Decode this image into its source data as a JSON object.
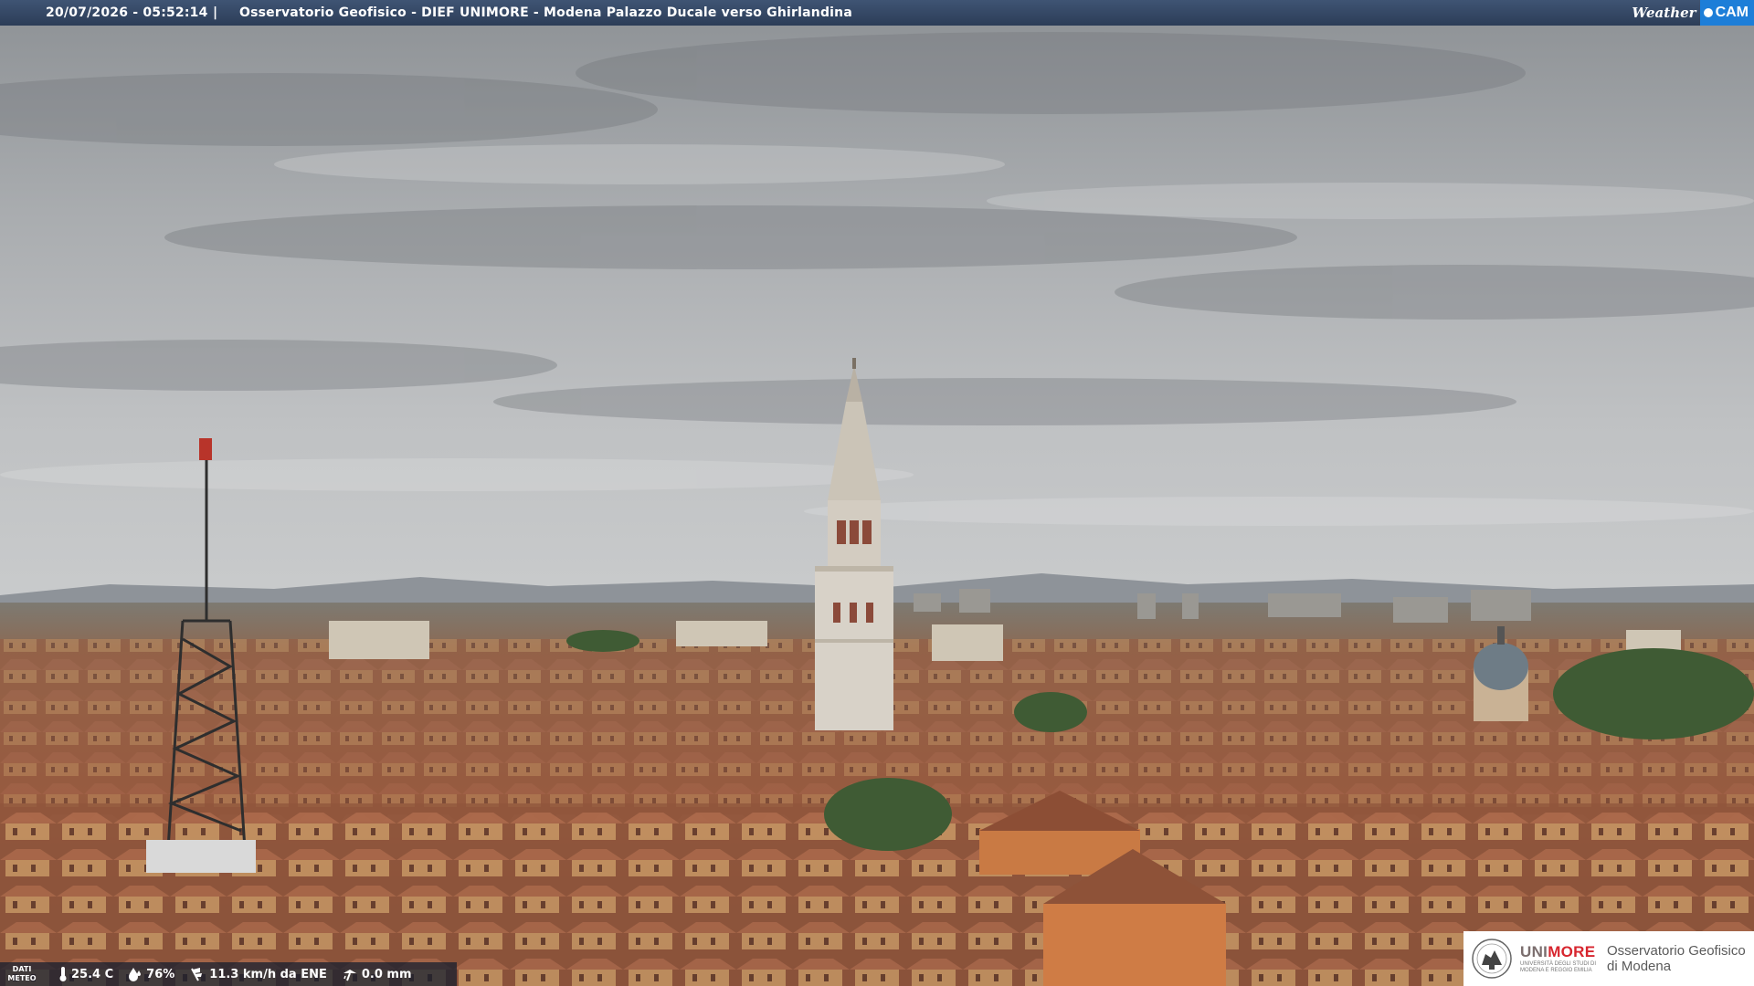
{
  "overlay": {
    "datetime": "20/07/2026 - 05:52:14",
    "separator": "|",
    "title": "Osservatorio Geofisico - DIEF UNIMORE - Modena Palazzo Ducale verso Ghirlandina"
  },
  "brand": {
    "weather": "Weather",
    "cam": "CAM"
  },
  "weather_bar": {
    "label_line1": "DATI",
    "label_line2": "METEO",
    "temperature": "25.4 C",
    "humidity": "76%",
    "wind": "11.3 km/h da ENE",
    "rain": "0.0 mm",
    "icons": [
      "thermometer-icon",
      "humidity-drop-icon",
      "wind-icon",
      "rain-gauge-icon"
    ]
  },
  "logo": {
    "name_part1": "UNI",
    "name_part2": "MORE",
    "subtitle_line1": "UNIVERSITÀ DEGLI STUDI DI",
    "subtitle_line2": "MODENA E REGGIO EMILIA",
    "observatory_line1": "Osservatorio Geofisico",
    "observatory_line2": "di Modena"
  },
  "colors": {
    "sky": "#b9bcbe",
    "roof": "#9b5b40",
    "tower": "#d9d4cc",
    "bar": "#2c3d57",
    "brand_red": "#d7262f",
    "brand_blue": "#1d7ed8"
  }
}
